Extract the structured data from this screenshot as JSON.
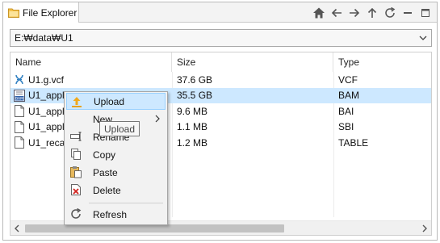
{
  "window": {
    "tab_title": "File Explorer",
    "toolbar": [
      {
        "name": "home-icon"
      },
      {
        "name": "back-arrow-icon"
      },
      {
        "name": "forward-arrow-icon"
      },
      {
        "name": "up-arrow-icon"
      },
      {
        "name": "refresh-icon"
      },
      {
        "name": "minimize-icon"
      },
      {
        "name": "maximize-icon"
      }
    ]
  },
  "path": {
    "value": "E:₩data₩U1"
  },
  "table": {
    "columns": [
      "Name",
      "Size",
      "Type"
    ],
    "rows": [
      {
        "name": "U1.g.vcf",
        "size": "37.6 GB",
        "type": "VCF",
        "icon": "vcf-file-icon"
      },
      {
        "name": "U1_apply.bam",
        "size": "35.5 GB",
        "type": "BAM",
        "icon": "bam-file-icon",
        "selected": true
      },
      {
        "name": "U1_apply.bai",
        "size": "9.6 MB",
        "type": "BAI",
        "icon": "file-icon"
      },
      {
        "name": "U1_apply.sbi",
        "size": "1.1 MB",
        "type": "SBI",
        "icon": "file-icon"
      },
      {
        "name": "U1_recal.table",
        "size": "1.2 MB",
        "type": "TABLE",
        "icon": "file-icon"
      }
    ]
  },
  "context_menu": {
    "items": [
      {
        "label": "Upload",
        "icon": "upload-icon",
        "highlighted": true
      },
      {
        "label": "New",
        "icon": "",
        "submenu": true
      },
      {
        "label": "Rename",
        "icon": "rename-icon"
      },
      {
        "label": "Copy",
        "icon": "copy-icon"
      },
      {
        "label": "Paste",
        "icon": "paste-icon"
      },
      {
        "label": "Delete",
        "icon": "delete-icon"
      },
      {
        "label": "Refresh",
        "icon": "refresh-icon"
      }
    ]
  },
  "tooltip": {
    "text": "Upload"
  },
  "colors": {
    "selection": "#cde8ff",
    "menu_background": "#f2f2f2",
    "accent": "#1e7fd6"
  }
}
